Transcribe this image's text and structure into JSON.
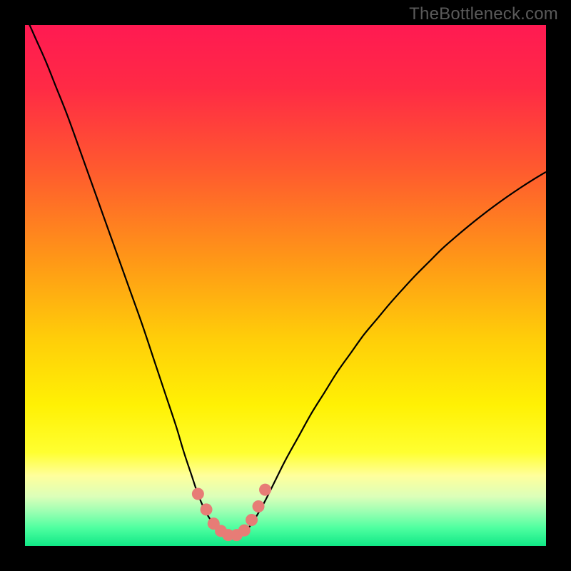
{
  "watermark": "TheBottleneck.com",
  "colors": {
    "frame": "#000000",
    "gradient_stops": [
      {
        "offset": 0.0,
        "color": "#ff1a52"
      },
      {
        "offset": 0.12,
        "color": "#ff2a45"
      },
      {
        "offset": 0.28,
        "color": "#ff5b2e"
      },
      {
        "offset": 0.45,
        "color": "#ff9717"
      },
      {
        "offset": 0.6,
        "color": "#ffcd09"
      },
      {
        "offset": 0.73,
        "color": "#fff104"
      },
      {
        "offset": 0.82,
        "color": "#ffff30"
      },
      {
        "offset": 0.865,
        "color": "#ffff9c"
      },
      {
        "offset": 0.905,
        "color": "#dcffb9"
      },
      {
        "offset": 0.935,
        "color": "#99ffb2"
      },
      {
        "offset": 0.965,
        "color": "#4fffa0"
      },
      {
        "offset": 1.0,
        "color": "#10e886"
      }
    ],
    "curve": "#000000",
    "marker_fill": "#e77c76",
    "marker_stroke": "#c85a54"
  },
  "chart_data": {
    "type": "line",
    "title": "",
    "xlabel": "",
    "ylabel": "",
    "xlim": [
      0,
      100
    ],
    "ylim": [
      0,
      100
    ],
    "grid": false,
    "legend": false,
    "series": [
      {
        "name": "bottleneck-curve",
        "x": [
          0,
          2,
          4,
          6,
          8,
          10,
          12.5,
          15,
          17.5,
          20,
          22.5,
          25,
          27,
          29,
          30.5,
          32,
          33,
          34,
          35,
          36,
          37,
          38,
          39,
          40,
          41,
          42,
          43,
          44,
          46,
          48,
          50,
          52.5,
          55,
          57.5,
          60,
          62.5,
          65,
          67.5,
          70,
          72.5,
          75,
          77.5,
          80,
          82.5,
          85,
          87.5,
          90,
          92.5,
          95,
          97.5,
          100
        ],
        "y": [
          102,
          97.5,
          93,
          88,
          83,
          77.5,
          70.5,
          63.5,
          56.5,
          49.5,
          42.5,
          35,
          29,
          23,
          18,
          13.5,
          10.5,
          8,
          6,
          4.5,
          3.3,
          2.5,
          2.1,
          2,
          2.1,
          2.6,
          3.6,
          5,
          8.5,
          12.5,
          16.5,
          21,
          25.5,
          29.5,
          33.5,
          37,
          40.5,
          43.5,
          46.5,
          49.3,
          52,
          54.5,
          57,
          59.2,
          61.3,
          63.3,
          65.2,
          67,
          68.7,
          70.3,
          71.8
        ]
      }
    ],
    "markers": {
      "name": "highlight-points",
      "x": [
        33.2,
        34.8,
        36.2,
        37.6,
        39.0,
        40.6,
        42.1,
        43.5,
        44.8,
        46.1
      ],
      "y": [
        10.0,
        7.0,
        4.3,
        2.9,
        2.1,
        2.1,
        3.0,
        5.0,
        7.6,
        10.8
      ]
    }
  }
}
